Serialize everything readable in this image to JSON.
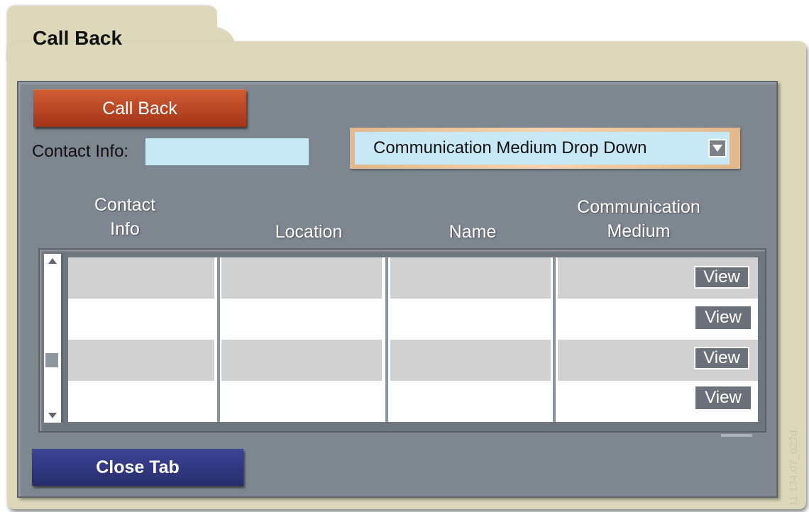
{
  "tab": {
    "title": "Call Back"
  },
  "actions": {
    "call_back_label": "Call Back",
    "close_tab_label": "Close Tab"
  },
  "contact": {
    "label": "Contact Info:",
    "value": ""
  },
  "dropdown": {
    "label": "Communication Medium Drop Down",
    "arrow_icon": "triangle-down-icon"
  },
  "table": {
    "columns": [
      {
        "label": "Contact\nInfo"
      },
      {
        "label": "Location"
      },
      {
        "label": "Name"
      },
      {
        "label": "Communication\nMedium"
      }
    ],
    "rows": [
      {
        "contact": "",
        "location": "",
        "name": "",
        "view_label": "View"
      },
      {
        "contact": "",
        "location": "",
        "name": "",
        "view_label": "View"
      },
      {
        "contact": "",
        "location": "",
        "name": "",
        "view_label": "View"
      },
      {
        "contact": "",
        "location": "",
        "name": "",
        "view_label": "View"
      }
    ]
  },
  "watermark": "11.134.07_022d",
  "colors": {
    "call_back_button": "#b8401f",
    "close_tab_button": "#2f3680",
    "panel": "#7e8790",
    "folder": "#dcd8b9",
    "input": "#c7e8f5"
  }
}
